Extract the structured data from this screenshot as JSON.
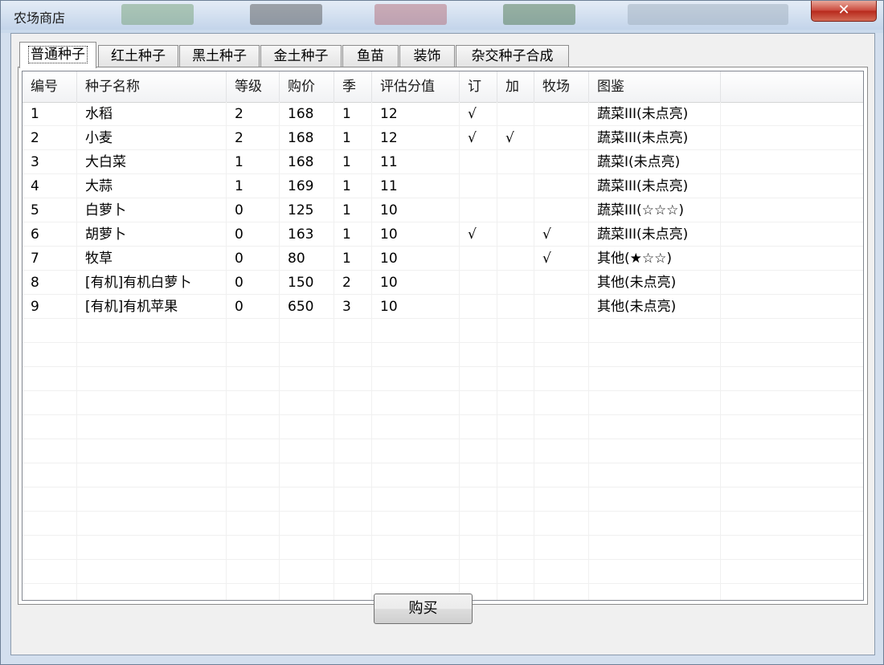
{
  "window": {
    "title": "农场商店",
    "close_label": "✕"
  },
  "tabs": [
    {
      "label": "普通种子",
      "active": true
    },
    {
      "label": "红土种子"
    },
    {
      "label": "黑土种子"
    },
    {
      "label": "金土种子"
    },
    {
      "label": "鱼苗"
    },
    {
      "label": "装饰"
    },
    {
      "label": "杂交种子合成"
    }
  ],
  "table": {
    "columns": [
      "编号",
      "种子名称",
      "等级",
      "购价",
      "季",
      "评估分值",
      "订",
      "加",
      "牧场",
      "图鉴"
    ],
    "rows": [
      [
        "1",
        "水稻",
        "2",
        "168",
        "1",
        "12",
        "√",
        "",
        "",
        "蔬菜III(未点亮)"
      ],
      [
        "2",
        "小麦",
        "2",
        "168",
        "1",
        "12",
        "√",
        "√",
        "",
        "蔬菜III(未点亮)"
      ],
      [
        "3",
        "大白菜",
        "1",
        "168",
        "1",
        "11",
        "",
        "",
        "",
        "蔬菜Ⅰ(未点亮)"
      ],
      [
        "4",
        "大蒜",
        "1",
        "169",
        "1",
        "11",
        "",
        "",
        "",
        "蔬菜III(未点亮)"
      ],
      [
        "5",
        "白萝卜",
        "0",
        "125",
        "1",
        "10",
        "",
        "",
        "",
        "蔬菜III(☆☆☆)"
      ],
      [
        "6",
        "胡萝卜",
        "0",
        "163",
        "1",
        "10",
        "√",
        "",
        "√",
        "蔬菜III(未点亮)"
      ],
      [
        "7",
        "牧草",
        "0",
        "80",
        "1",
        "10",
        "",
        "",
        "√",
        "其他(★☆☆)"
      ],
      [
        "8",
        "[有机]有机白萝卜",
        "0",
        "150",
        "2",
        "10",
        "",
        "",
        "",
        "其他(未点亮)"
      ],
      [
        "9",
        "[有机]有机苹果",
        "0",
        "650",
        "3",
        "10",
        "",
        "",
        "",
        "其他(未点亮)"
      ]
    ]
  },
  "buttons": {
    "buy": "购买"
  }
}
